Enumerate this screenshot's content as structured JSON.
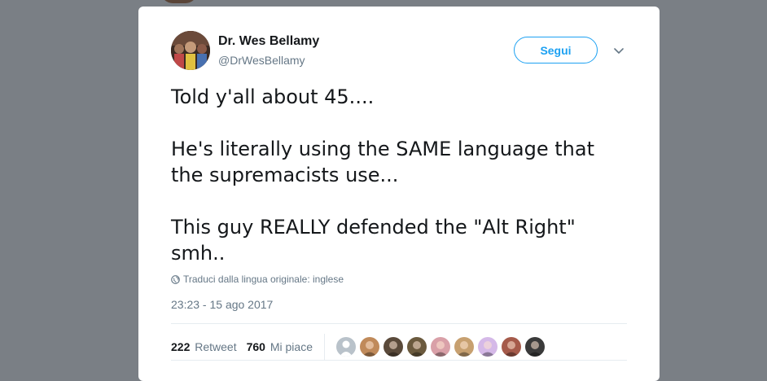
{
  "tweet": {
    "author_name": "Dr. Wes Bellamy",
    "author_handle": "@DrWesBellamy",
    "follow_label": "Segui",
    "text_paragraphs": [
      "Told y'all about 45....",
      "He's literally using the SAME language that the supremacists use...",
      "This guy REALLY defended the \"Alt Right\" smh.."
    ],
    "translate_label": "Traduci dalla lingua originale: inglese",
    "timestamp": "23:23 - 15 ago 2017",
    "retweet_count": "222",
    "retweet_label": "Retweet",
    "like_count": "760",
    "like_label": "Mi piace"
  },
  "colors": {
    "backdrop": "#7a7f85",
    "accent": "#1da1f2",
    "text_primary": "#14171a",
    "text_secondary": "#657786",
    "divider": "#e6ecf0"
  },
  "icons": {
    "caret": "chevron-down-icon",
    "translate": "globe-icon"
  },
  "likers": [
    {
      "color": "#b9c2ca"
    },
    {
      "color": "#c08a5a"
    },
    {
      "color": "#5a4a3a"
    },
    {
      "color": "#6b5a3e"
    },
    {
      "color": "#d9a0a8"
    },
    {
      "color": "#c7a070"
    },
    {
      "color": "#d5b9e8"
    },
    {
      "color": "#a55a4a"
    },
    {
      "color": "#3a3a3a"
    }
  ]
}
